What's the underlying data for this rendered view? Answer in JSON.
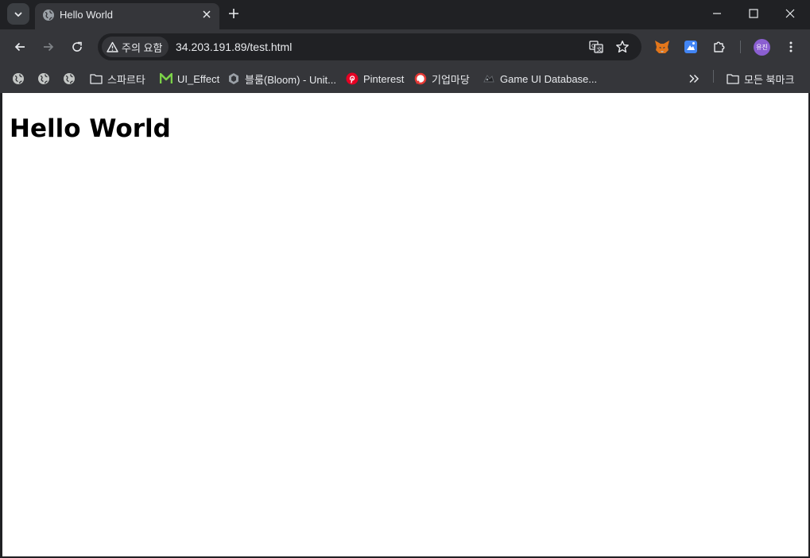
{
  "tab": {
    "title": "Hello World"
  },
  "toolbar": {
    "security_chip": "주의 요함",
    "url": "34.203.191.89/test.html",
    "avatar_text": "유진"
  },
  "bookmarks": [
    {
      "label": "",
      "icon": "globe-icon"
    },
    {
      "label": "",
      "icon": "globe-icon"
    },
    {
      "label": "",
      "icon": "globe-icon"
    },
    {
      "label": "스파르타",
      "icon": "folder-icon"
    },
    {
      "label": "UI_Effect",
      "icon": "m-logo-icon",
      "color": "#7bd148"
    },
    {
      "label": "블룸(Bloom) - Unit...",
      "icon": "unity-icon"
    },
    {
      "label": "Pinterest",
      "icon": "pinterest-icon",
      "color": "#e60023"
    },
    {
      "label": "기업마당",
      "icon": "bizinfo-icon",
      "color": "#e53935"
    },
    {
      "label": "Game UI Database...",
      "icon": "gameui-icon"
    }
  ],
  "all_bookmarks": {
    "label": "모든 북마크",
    "icon": "folder-icon"
  },
  "page": {
    "heading": "Hello World"
  },
  "colors": {
    "chrome_dark": "#202124",
    "toolbar": "#35363a",
    "text": "#e8eaed",
    "avatar": "#8b5fd1"
  }
}
